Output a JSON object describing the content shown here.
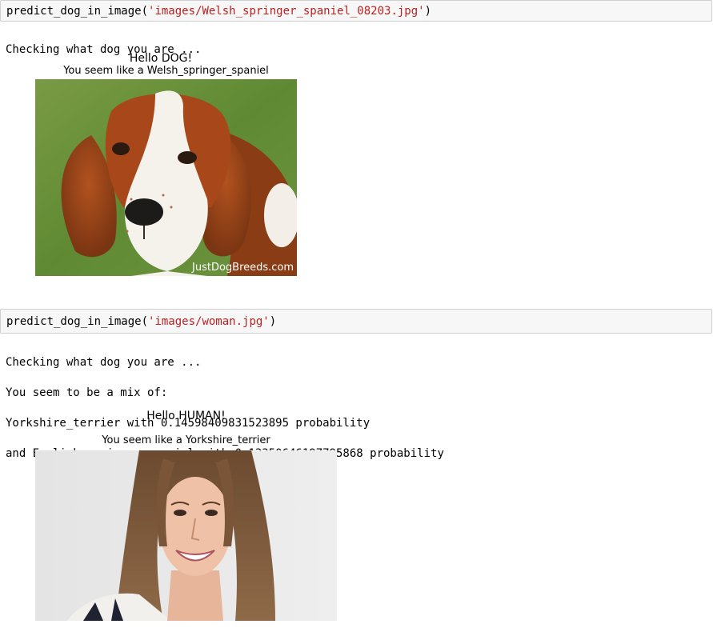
{
  "cells": [
    {
      "code_fn": "predict_dog_in_image(",
      "code_arg": "'images/Welsh_springer_spaniel_08203.jpg'",
      "code_close": ")",
      "output_lines": [
        "Checking what dog you are ..."
      ],
      "figure": {
        "title": "Hello DOG!",
        "subtitle": "You seem like a Welsh_springer_spaniel",
        "image_label": "dog photo",
        "watermark": "JustDogBreeds.com"
      }
    },
    {
      "code_fn": "predict_dog_in_image(",
      "code_arg": "'images/woman.jpg'",
      "code_close": ")",
      "output_lines": [
        "Checking what dog you are ...",
        "You seem to be a mix of:",
        "Yorkshire_terrier with 0.14598409831523895 probability",
        "and English_springer_spaniel with 0.13350646197795868 probability"
      ],
      "figure": {
        "title": "Hello HUMAN!",
        "subtitle": "You seem like a Yorkshire_terrier",
        "image_label": "woman photo"
      }
    }
  ],
  "colors": {
    "cell_bg": "#f7f7f7",
    "cell_border": "#cfcfcf",
    "string": "#ba2121"
  }
}
